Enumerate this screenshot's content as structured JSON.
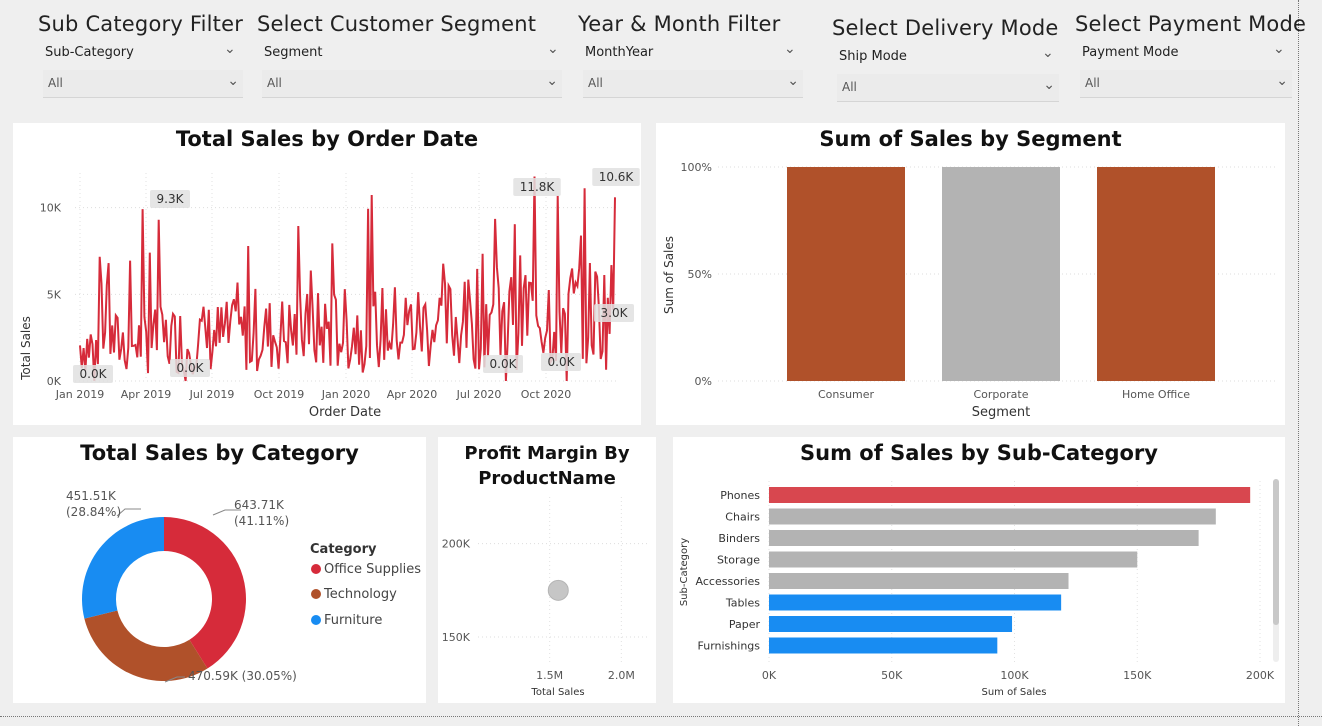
{
  "colors": {
    "accent_red": "#d62b3a",
    "brown": "#b0512a",
    "grey": "#b3b3b3",
    "blue": "#188cf2"
  },
  "slicers": [
    {
      "title": "Sub Category Filter",
      "field": "Sub-Category",
      "value": "All"
    },
    {
      "title": "Select Customer Segment",
      "field": "Segment",
      "value": "All"
    },
    {
      "title": "Year & Month Filter",
      "field": "MonthYear",
      "value": "All"
    },
    {
      "title": "Select Delivery Mode",
      "field": "Ship Mode",
      "value": "All"
    },
    {
      "title": "Select Payment Mode",
      "field": "Payment Mode",
      "value": "All"
    }
  ],
  "line_chart": {
    "title": "Total Sales by Order Date",
    "xlabel": "Order Date",
    "ylabel": "Total Sales",
    "y_ticks": [
      "0K",
      "5K",
      "10K"
    ],
    "x_ticks": [
      "Jan 2019",
      "Apr 2019",
      "Jul 2019",
      "Oct 2019",
      "Jan 2020",
      "Apr 2020",
      "Jul 2020",
      "Oct 2020"
    ],
    "data_labels": [
      "9.3K",
      "11.8K",
      "10.6K",
      "0.0K",
      "0.0K",
      "0.0K",
      "3.0K",
      "0.0K"
    ]
  },
  "segment_chart": {
    "title": "Sum of Sales by Segment",
    "xlabel": "Segment",
    "ylabel": "Sum of Sales",
    "y_ticks": [
      "0%",
      "50%",
      "100%"
    ]
  },
  "category_chart": {
    "title": "Total Sales by Category",
    "legend_title": "Category",
    "labels": [
      "643.71K\n(41.11%)",
      "470.59K (30.05%)",
      "451.51K\n(28.84%)"
    ]
  },
  "profit_chart": {
    "title_line1": "Profit Margin By",
    "title_line2": "ProductName",
    "xlabel": "Total Sales",
    "y_ticks": [
      "150K",
      "200K"
    ],
    "x_ticks": [
      "1.5M",
      "2.0M"
    ]
  },
  "subcat_chart": {
    "title": "Sum of Sales by Sub-Category",
    "xlabel": "Sum of Sales",
    "ylabel": "Sub-Category",
    "x_ticks": [
      "0K",
      "50K",
      "100K",
      "150K",
      "200K"
    ]
  },
  "chart_data": [
    {
      "type": "line",
      "title": "Total Sales by Order Date",
      "xlabel": "Order Date",
      "ylabel": "Total Sales",
      "x_range": [
        "2019-01-01",
        "2020-12-31"
      ],
      "ylim": [
        0,
        12000
      ],
      "series": [
        {
          "values_note_free": true,
          "highlights": [
            {
              "x": "2019-03-25",
              "y": 9300
            },
            {
              "x": "2020-08-20",
              "y": 11800
            },
            {
              "x": "2020-12-10",
              "y": 10600
            }
          ]
        }
      ]
    },
    {
      "type": "bar",
      "title": "Sum of Sales by Segment",
      "xlabel": "Segment",
      "ylabel": "Sum of Sales",
      "categories": [
        "Consumer",
        "Corporate",
        "Home Office"
      ],
      "values": [
        100,
        100,
        100
      ],
      "ylim": [
        0,
        100
      ],
      "colors": [
        "#b0512a",
        "#b3b3b3",
        "#b0512a"
      ]
    },
    {
      "type": "pie",
      "title": "Total Sales by Category",
      "categories": [
        "Office Supplies",
        "Technology",
        "Furniture"
      ],
      "values": [
        643.71,
        470.59,
        451.51
      ],
      "percents": [
        41.11,
        30.05,
        28.84
      ],
      "colors": [
        "#d62b3a",
        "#b0512a",
        "#188cf2"
      ]
    },
    {
      "type": "scatter",
      "title": "Profit Margin By ProductName",
      "xlabel": "Total Sales",
      "points": [
        {
          "x": 1.56,
          "y": 175
        }
      ],
      "xlim": [
        1.0,
        2.2
      ],
      "ylim": [
        135,
        225
      ]
    },
    {
      "type": "bar",
      "orientation": "horizontal",
      "title": "Sum of Sales by Sub-Category",
      "xlabel": "Sum of Sales",
      "ylabel": "Sub-Category",
      "categories": [
        "Phones",
        "Chairs",
        "Binders",
        "Storage",
        "Accessories",
        "Tables",
        "Paper",
        "Furnishings"
      ],
      "values": [
        196,
        182,
        175,
        150,
        122,
        119,
        99,
        93
      ],
      "xlim": [
        0,
        210
      ],
      "colors": [
        "#d8474f",
        "#b3b3b3",
        "#b3b3b3",
        "#b3b3b3",
        "#b3b3b3",
        "#188cf2",
        "#188cf2",
        "#188cf2"
      ]
    }
  ]
}
